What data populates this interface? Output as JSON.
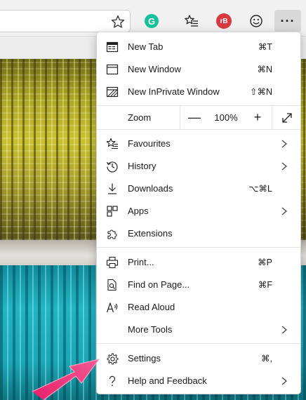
{
  "toolbar": {
    "grammarly_letter": "G",
    "rb_label": "rB",
    "more_label": "···"
  },
  "menu": {
    "new_tab": {
      "label": "New Tab",
      "shortcut": "⌘T"
    },
    "new_window": {
      "label": "New Window",
      "shortcut": "⌘N"
    },
    "new_inprivate": {
      "label": "New InPrivate Window",
      "shortcut": "⇧⌘N"
    },
    "zoom": {
      "label": "Zoom",
      "minus": "—",
      "value": "100%",
      "plus": "+"
    },
    "favourites": {
      "label": "Favourites"
    },
    "history": {
      "label": "History"
    },
    "downloads": {
      "label": "Downloads",
      "shortcut": "⌥⌘L"
    },
    "apps": {
      "label": "Apps"
    },
    "extensions": {
      "label": "Extensions"
    },
    "print": {
      "label": "Print...",
      "shortcut": "⌘P"
    },
    "find": {
      "label": "Find on Page...",
      "shortcut": "⌘F"
    },
    "read_aloud": {
      "label": "Read Aloud"
    },
    "more_tools": {
      "label": "More Tools"
    },
    "settings": {
      "label": "Settings",
      "shortcut": "⌘,"
    },
    "help": {
      "label": "Help and Feedback"
    }
  },
  "colors": {
    "arrow": "#f0337a",
    "grammarly": "#15c39a",
    "rb": "#d9393e"
  }
}
